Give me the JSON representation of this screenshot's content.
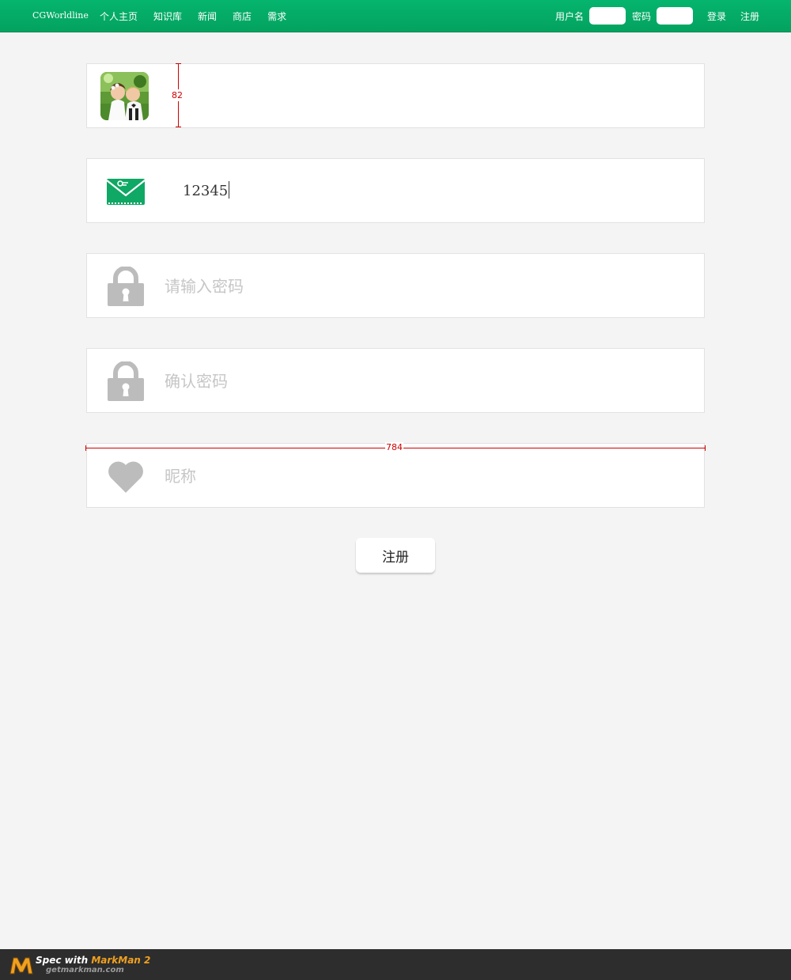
{
  "header": {
    "brand": "CGWorldline",
    "nav": [
      "个人主页",
      "知识库",
      "新闻",
      "商店",
      "需求"
    ],
    "username_label": "用户名",
    "password_label": "密码",
    "login_link": "登录",
    "register_link": "注册"
  },
  "form": {
    "email_value": "12345",
    "password_placeholder": "请输入密码",
    "confirm_placeholder": "确认密码",
    "nickname_placeholder": "昵称",
    "submit_label": "注册"
  },
  "annotations": {
    "height_measure": "82",
    "width_measure": "784"
  },
  "footer": {
    "spec_with": "Spec with ",
    "markman": "MarkMan 2",
    "site": "getmarkman.com"
  },
  "colors": {
    "header_green": "#05b56e",
    "icon_gray": "#bcbcbc",
    "envelope_green": "#0fa864",
    "measure_red": "#cc0000"
  }
}
